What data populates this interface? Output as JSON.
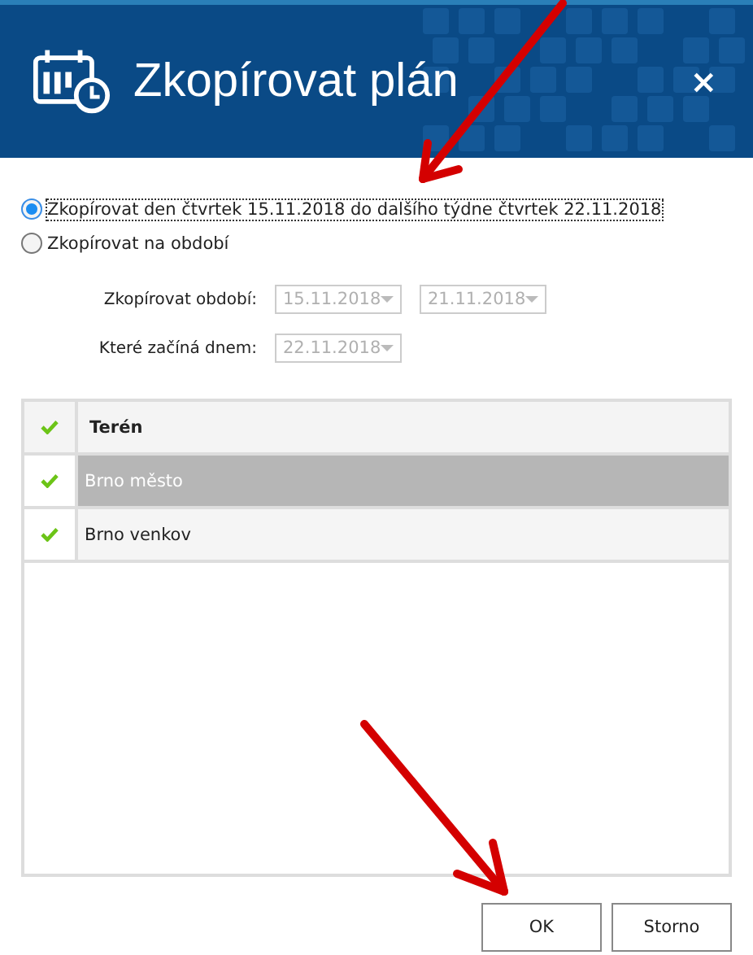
{
  "window": {
    "title": "Zkopírovat plán",
    "close": "×"
  },
  "options": [
    {
      "label": "Zkopírovat den čtvrtek 15.11.2018 do dalšího týdne čtvrtek 22.11.2018",
      "selected": true,
      "focused": true
    },
    {
      "label": "Zkopírovat na období",
      "selected": false,
      "focused": false
    }
  ],
  "fields": [
    {
      "label": "Zkopírovat období:",
      "values": [
        "15.11.2018",
        "21.11.2018"
      ],
      "disabled": true
    },
    {
      "label": "Které začíná dnem:",
      "values": [
        "22.11.2018"
      ],
      "disabled": true
    }
  ],
  "table": {
    "columns": [
      "Terén"
    ],
    "header_checked": true,
    "rows": [
      {
        "name": "Brno město",
        "checked": true,
        "selected": true
      },
      {
        "name": "Brno venkov",
        "checked": true,
        "selected": false
      }
    ]
  },
  "buttons": [
    "OK",
    "Storno"
  ]
}
